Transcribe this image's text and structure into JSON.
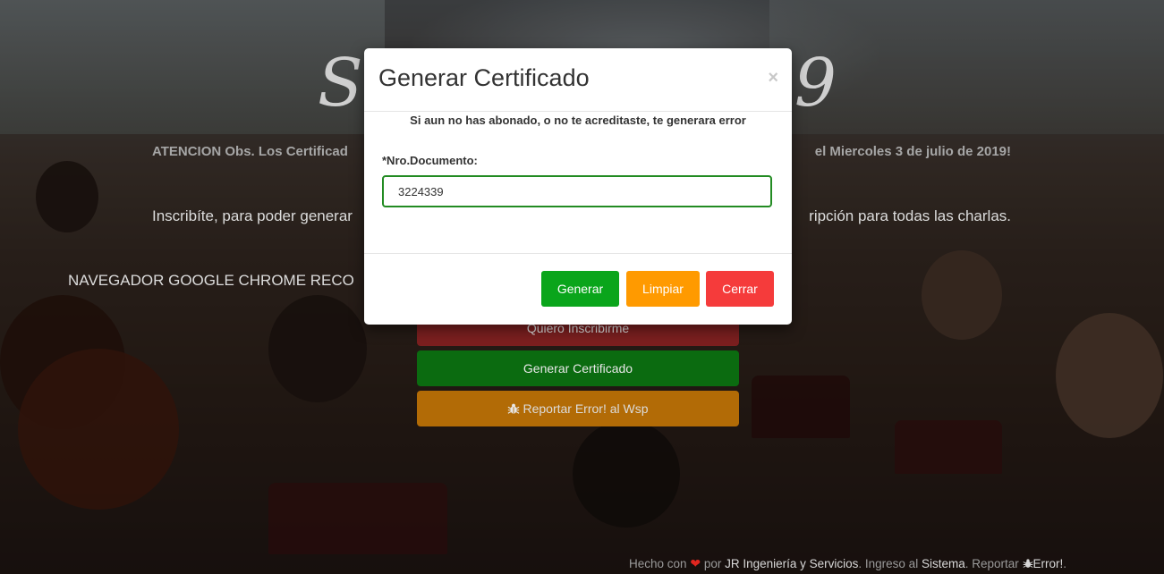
{
  "background": {
    "hero_title_start": "Se",
    "hero_title_end": "19",
    "notice_start": "ATENCION Obs. Los Certificad",
    "notice_end": "el Miercoles 3 de julio de 2019!",
    "subscribe_start": "Inscribíte, para poder generar",
    "subscribe_end": "ripción para todas las charlas.",
    "browser_text": "NAVEGADOR GOOGLE CHROME RECO",
    "buttons": {
      "inscribirme": "Quiero Inscribirme",
      "generar_certificado": "Generar Certificado",
      "reportar": "Reportar Error! al Wsp"
    }
  },
  "footer": {
    "hecho_con": "Hecho con",
    "por": "por",
    "company": "JR Ingeniería y Servicios",
    "ingreso": ". Ingreso al",
    "sistema": "Sistema",
    "reportar": ". Reportar",
    "error": "Error!",
    "end": "."
  },
  "modal": {
    "title": "Generar Certificado",
    "close": "×",
    "warning": "Si aun no has abonado, o no te acreditaste, te generara error",
    "field_label": "*Nro.Documento:",
    "field_value": "3224339",
    "buttons": {
      "generar": "Generar",
      "limpiar": "Limpiar",
      "cerrar": "Cerrar"
    }
  },
  "colors": {
    "generar": "#0aa51b",
    "limpiar": "#ff9a00",
    "cerrar": "#f53b3b",
    "input_border": "#228b22"
  },
  "icons": {
    "bug": "bug-icon",
    "heart": "heart-icon"
  }
}
